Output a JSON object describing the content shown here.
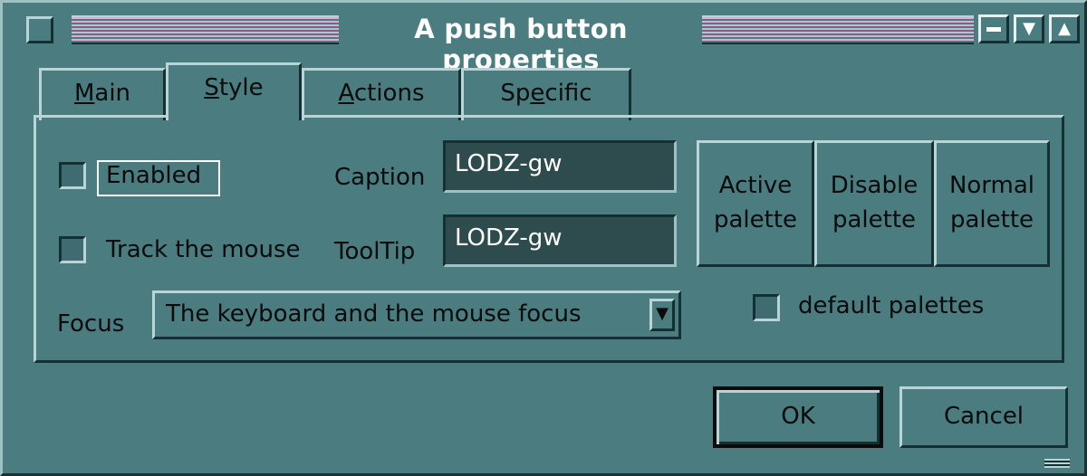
{
  "window": {
    "title": "A push button properties",
    "controls": {
      "minimize": "minimize-icon",
      "down": "triangle-down-icon",
      "up": "triangle-up-icon"
    }
  },
  "tabs": [
    {
      "label": "Main",
      "accel": "M",
      "rest": "ain"
    },
    {
      "label": "Style",
      "accel": "S",
      "rest": "tyle",
      "selected": true
    },
    {
      "label": "Actions",
      "accel": "A",
      "rest": "ctions"
    },
    {
      "label": "Specific",
      "pre": "Sp",
      "accel": "e",
      "rest": "cific"
    }
  ],
  "style": {
    "enabled_label": "Enabled",
    "enabled_checked": false,
    "track_mouse_label": "Track the mouse",
    "track_mouse_checked": false,
    "caption_label": "Caption",
    "caption_value": "LODZ-gw",
    "tooltip_label": "ToolTip",
    "tooltip_value": "LODZ-gw",
    "focus_label": "Focus",
    "focus_value": "The keyboard and the mouse focus",
    "palettes": [
      {
        "line1": "Active",
        "line2": "palette"
      },
      {
        "line1": "Disable",
        "line2": "palette"
      },
      {
        "line1": "Normal",
        "line2": "palette"
      }
    ],
    "default_palettes_label": "default palettes",
    "default_palettes_checked": false
  },
  "buttons": {
    "ok": "OK",
    "cancel": "Cancel"
  },
  "colors": {
    "window_bg": "#4a7c80",
    "title_stripes": "#e6a9d6",
    "field_bg": "#2e4b4d"
  }
}
